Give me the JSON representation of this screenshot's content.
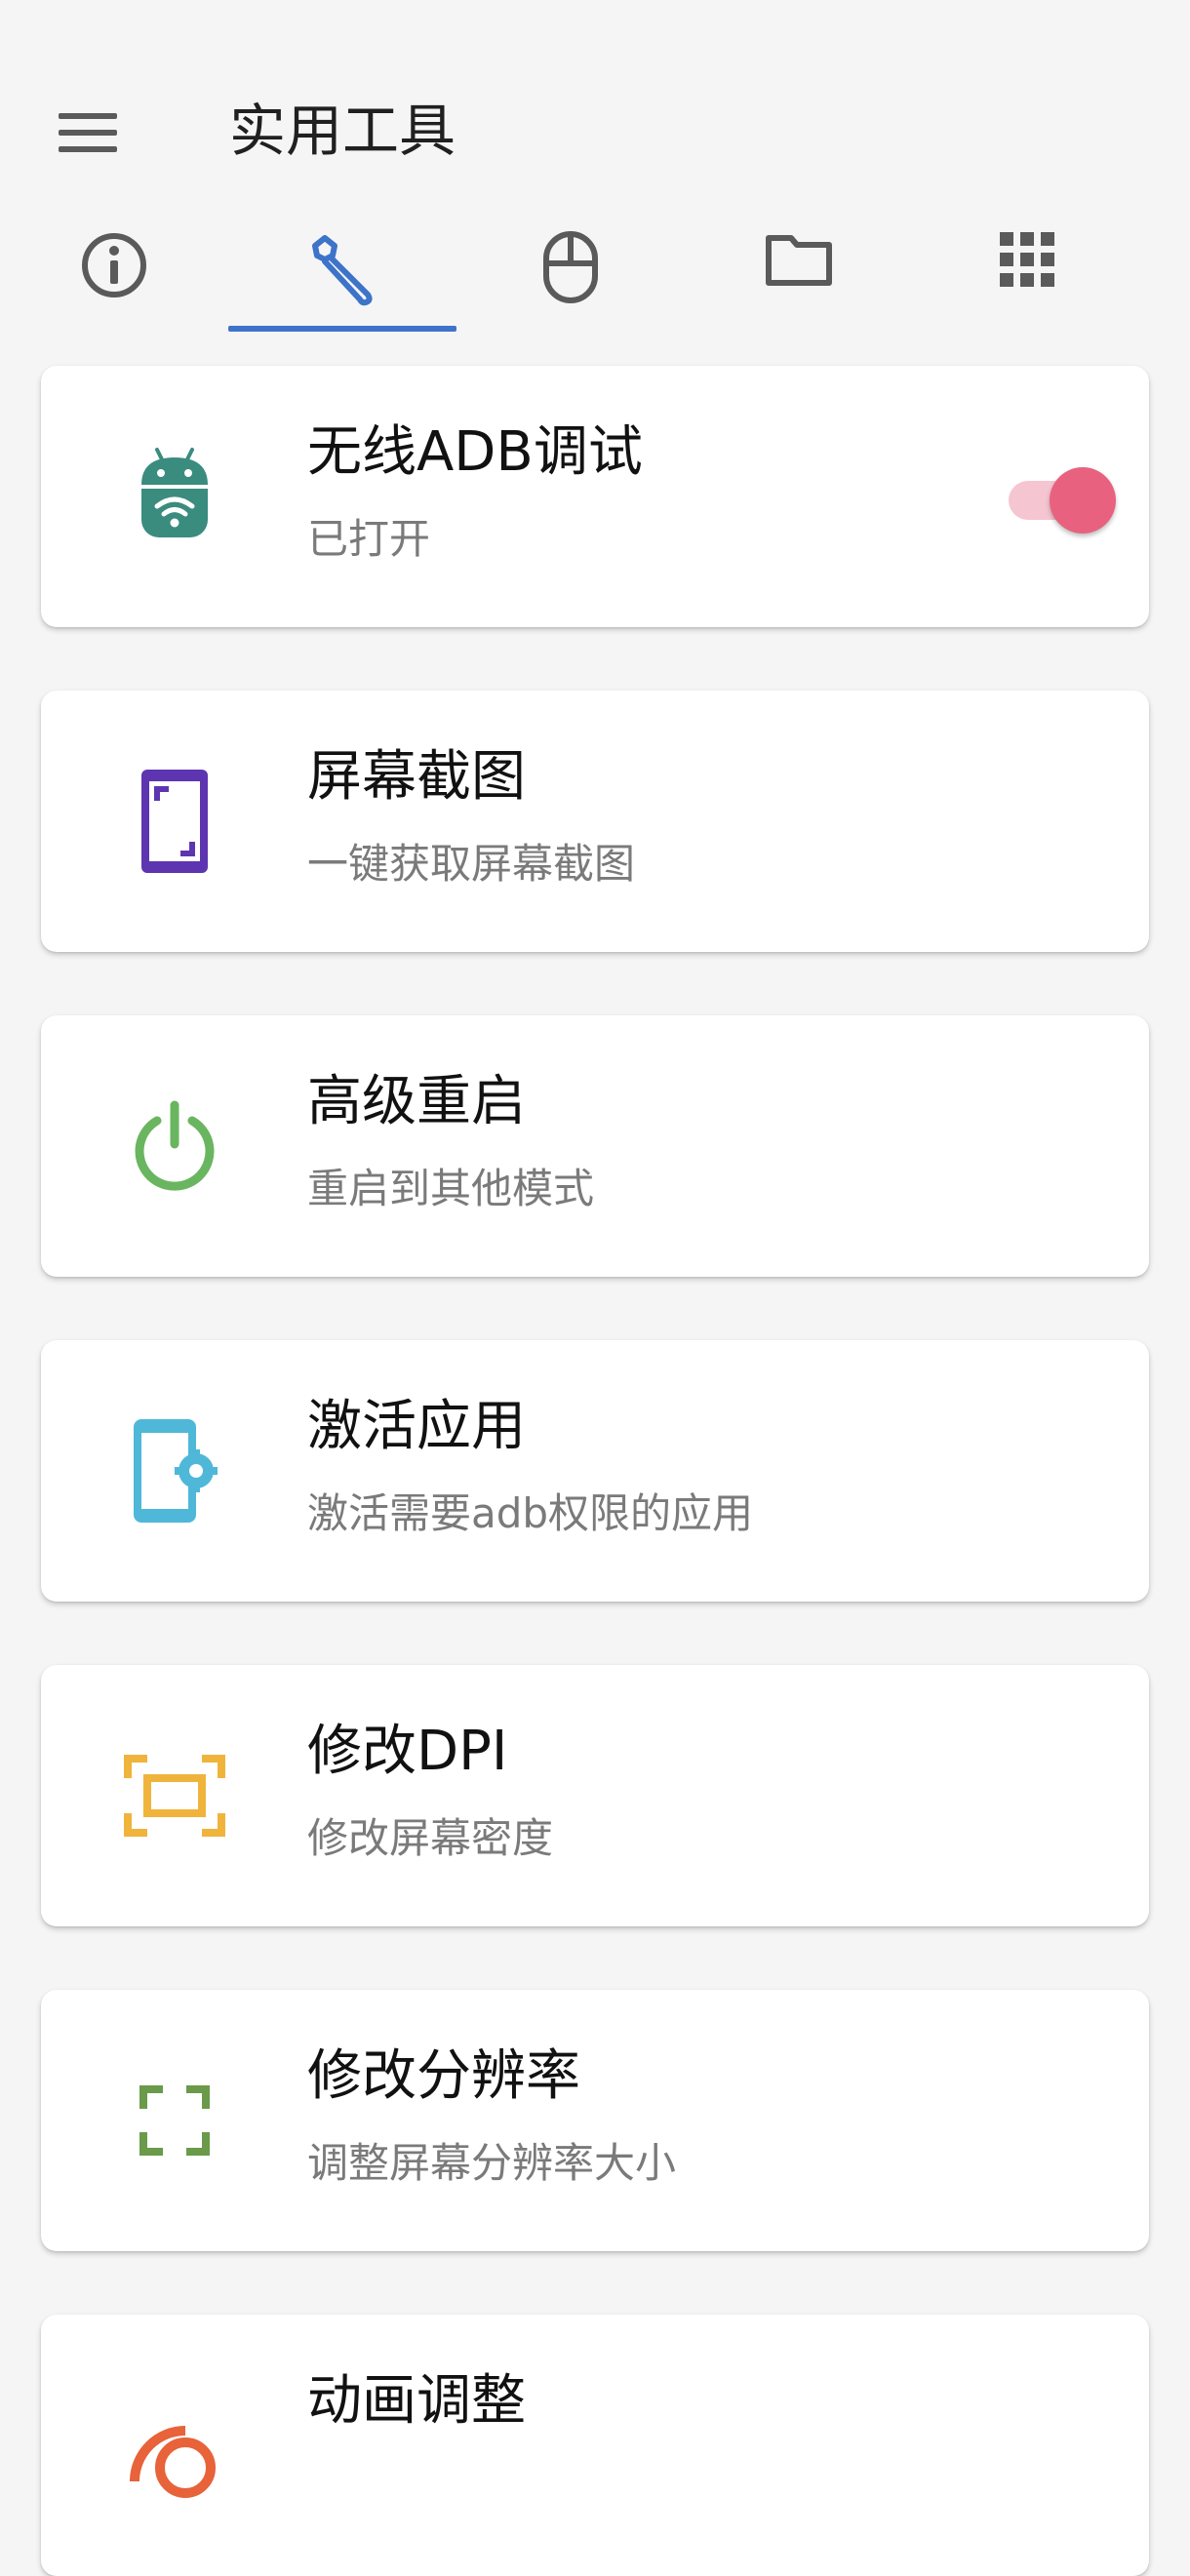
{
  "app": {
    "title": "实用工具"
  },
  "tabs": [
    {
      "name": "info",
      "icon": "info-icon"
    },
    {
      "name": "tools",
      "icon": "wrench-icon",
      "selected": true
    },
    {
      "name": "mouse",
      "icon": "mouse-icon"
    },
    {
      "name": "files",
      "icon": "folder-icon"
    },
    {
      "name": "apps",
      "icon": "grid-icon"
    }
  ],
  "colors": {
    "tab_indicator": "#3d73c9",
    "tab_selected_icon": "#3d73c9",
    "switch_thumb": "#e8627f",
    "switch_track": "#f6c5d2"
  },
  "cards": [
    {
      "title": "无线ADB调试",
      "subtitle": "已打开",
      "icon": "android-wifi-icon",
      "icon_color": "#3a8c7e",
      "toggle": true
    },
    {
      "title": "屏幕截图",
      "subtitle": "一键获取屏幕截图",
      "icon": "screenshot-icon",
      "icon_color": "#5e35b1"
    },
    {
      "title": "高级重启",
      "subtitle": "重启到其他模式",
      "icon": "power-icon",
      "icon_color": "#6ab55f"
    },
    {
      "title": "激活应用",
      "subtitle": "激活需要adb权限的应用",
      "icon": "phone-settings-icon",
      "icon_color": "#4fb8d8"
    },
    {
      "title": "修改DPI",
      "subtitle": "修改屏幕密度",
      "icon": "dpi-icon",
      "icon_color": "#f0b43c"
    },
    {
      "title": "修改分辨率",
      "subtitle": "调整屏幕分辨率大小",
      "icon": "resolution-icon",
      "icon_color": "#6a9a4a"
    },
    {
      "title": "动画调整",
      "subtitle": "",
      "icon": "animation-icon",
      "icon_color": "#e8623a"
    }
  ]
}
